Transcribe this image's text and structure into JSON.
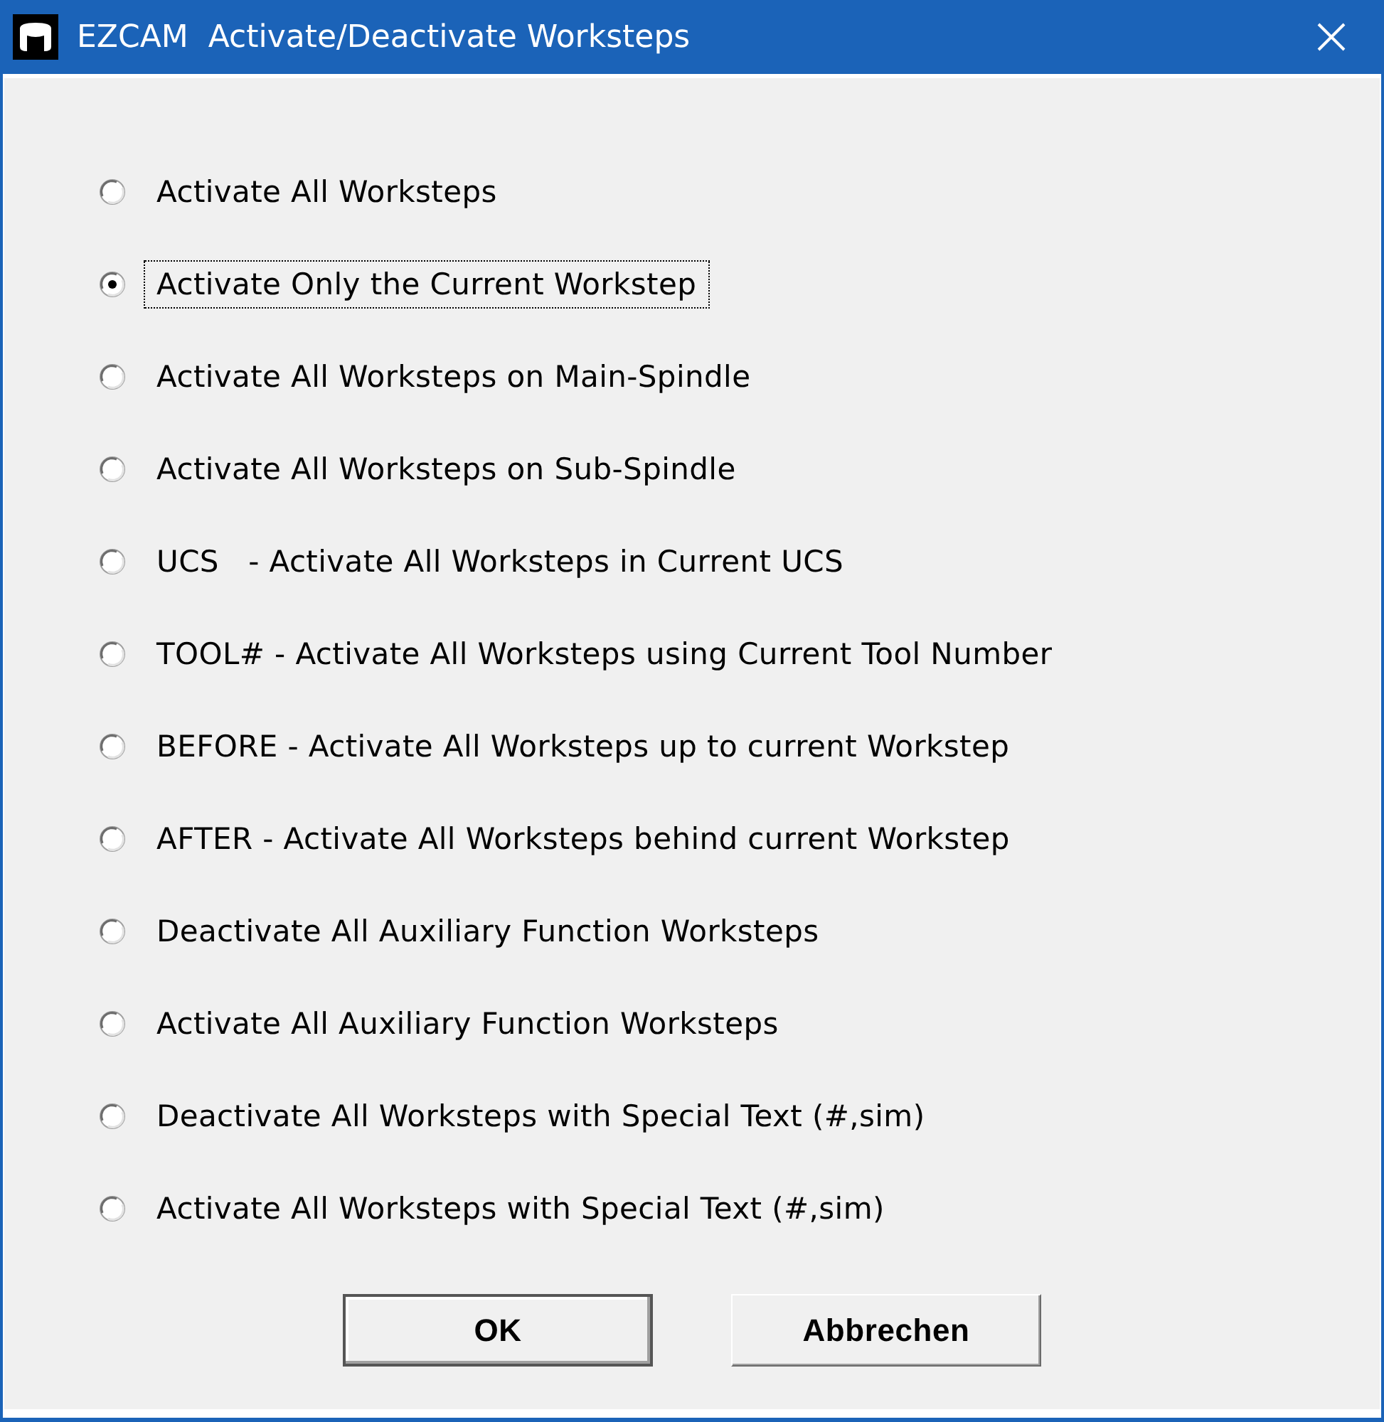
{
  "window": {
    "title": "EZCAM  Activate/Deactivate Worksteps"
  },
  "options": [
    {
      "label": "Activate All Worksteps",
      "selected": false,
      "focused": false
    },
    {
      "label": "Activate Only the Current Workstep",
      "selected": true,
      "focused": true
    },
    {
      "label": "Activate All Worksteps on Main-Spindle",
      "selected": false,
      "focused": false
    },
    {
      "label": "Activate All Worksteps on Sub-Spindle",
      "selected": false,
      "focused": false
    },
    {
      "label": "UCS   - Activate All Worksteps in Current UCS",
      "selected": false,
      "focused": false
    },
    {
      "label": "TOOL# - Activate All Worksteps using Current Tool Number",
      "selected": false,
      "focused": false
    },
    {
      "label": "BEFORE - Activate All Worksteps up to current Workstep",
      "selected": false,
      "focused": false
    },
    {
      "label": "AFTER - Activate All Worksteps behind current Workstep",
      "selected": false,
      "focused": false
    },
    {
      "label": "Deactivate All Auxiliary Function Worksteps",
      "selected": false,
      "focused": false
    },
    {
      "label": "Activate All Auxiliary Function Worksteps",
      "selected": false,
      "focused": false
    },
    {
      "label": "Deactivate All Worksteps with Special Text (#,sim)",
      "selected": false,
      "focused": false
    },
    {
      "label": "Activate All Worksteps with Special Text (#,sim)",
      "selected": false,
      "focused": false
    }
  ],
  "buttons": [
    {
      "label": "OK",
      "default": true
    },
    {
      "label": "Abbrechen",
      "default": false
    }
  ]
}
